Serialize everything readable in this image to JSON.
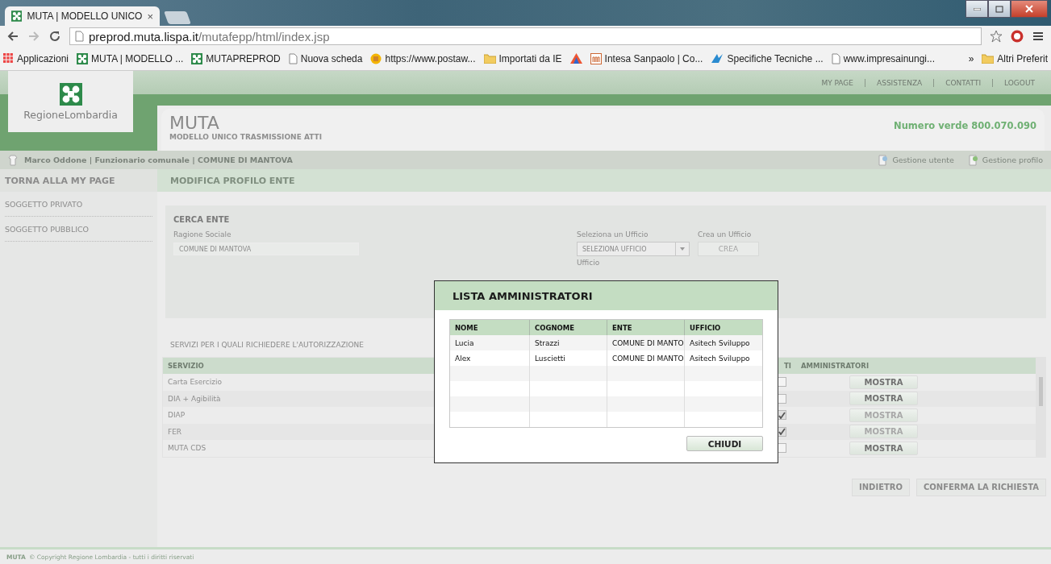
{
  "browser": {
    "tab": {
      "title": "MUTA | MODELLO UNICO",
      "close": "×"
    },
    "address": {
      "host": "preprod.muta.lispa.it",
      "path": "/mutafepp/html/index.jsp"
    },
    "bookmarks": [
      {
        "kind": "apps",
        "label": "Applicazioni"
      },
      {
        "kind": "logo",
        "label": "MUTA | MODELLO ..."
      },
      {
        "kind": "logo",
        "label": "MUTAPREPROD"
      },
      {
        "kind": "page",
        "label": "Nuova scheda"
      },
      {
        "kind": "coin",
        "label": "https://www.postaw..."
      },
      {
        "kind": "folder",
        "label": "Importati da IE"
      },
      {
        "kind": "triangle"
      },
      {
        "kind": "letter",
        "label": "Intesa Sanpaolo | Co..."
      },
      {
        "kind": "bird",
        "label": "Specifiche Tecniche ..."
      },
      {
        "kind": "page",
        "label": "www.impresainungi..."
      }
    ],
    "more": "»",
    "other_bookmarks": "Altri Preferit"
  },
  "header": {
    "brand": "RegioneLombardia",
    "links": [
      "MY PAGE",
      "ASSISTENZA",
      "CONTATTI",
      "LOGOUT"
    ],
    "app_title": "MUTA",
    "app_subtitle": "MODELLO UNICO TRASMISSIONE ATTI",
    "hotline": "Numero verde 800.070.090"
  },
  "user_bar": {
    "user": "Marco Oddone | Funzionario comunale | COMUNE DI MANTOVA",
    "actions": [
      "Gestione utente",
      "Gestione profilo"
    ]
  },
  "sidebar": {
    "back": "TORNA ALLA MY PAGE",
    "items": [
      "SOGGETTO PRIVATO",
      "SOGGETTO PUBBLICO"
    ]
  },
  "page_title": "MODIFICA PROFILO ENTE",
  "search": {
    "title": "CERCA ENTE",
    "name_label": "Ragione Sociale",
    "name_value": "COMUNE DI MANTOVA",
    "office_label": "Seleziona un Ufficio",
    "office_select": "SELEZIONA UFFICIO",
    "office_sub": "Ufficio",
    "create_label": "Crea un Ufficio",
    "create_button": "CREA"
  },
  "services": {
    "heading": "SERVIZI PER I QUALI RICHIEDERE L'AUTORIZZAZIONE",
    "columns": [
      "SERVIZIO",
      "TI",
      "AMMINISTRATORI"
    ],
    "rows": [
      {
        "name": "Carta Esercizio",
        "checked": false,
        "action": "MOSTRA",
        "disabled": false
      },
      {
        "name": "DIA + Agibilità",
        "checked": false,
        "action": "MOSTRA",
        "disabled": false
      },
      {
        "name": "DIAP",
        "checked": true,
        "action": "MOSTRA",
        "disabled": true
      },
      {
        "name": "FER",
        "checked": true,
        "action": "MOSTRA",
        "disabled": true
      },
      {
        "name": "MUTA CDS",
        "checked": false,
        "action": "MOSTRA",
        "disabled": false
      }
    ]
  },
  "buttons": [
    "INDIETRO",
    "CONFERMA LA RICHIESTA"
  ],
  "footer": {
    "brand": "MUTA",
    "text": "© Copyright Regione Lombardia - tutti i diritti riservati"
  },
  "modal": {
    "title": "LISTA AMMINISTRATORI",
    "columns": [
      "NOME",
      "COGNOME",
      "ENTE",
      "UFFICIO"
    ],
    "rows": [
      [
        "Lucia",
        "Strazzi",
        "COMUNE DI MANTO",
        "Asitech Sviluppo"
      ],
      [
        "Alex",
        "Luscietti",
        "COMUNE DI MANTO",
        "Asitech Sviluppo"
      ]
    ],
    "close": "CHIUDI"
  }
}
